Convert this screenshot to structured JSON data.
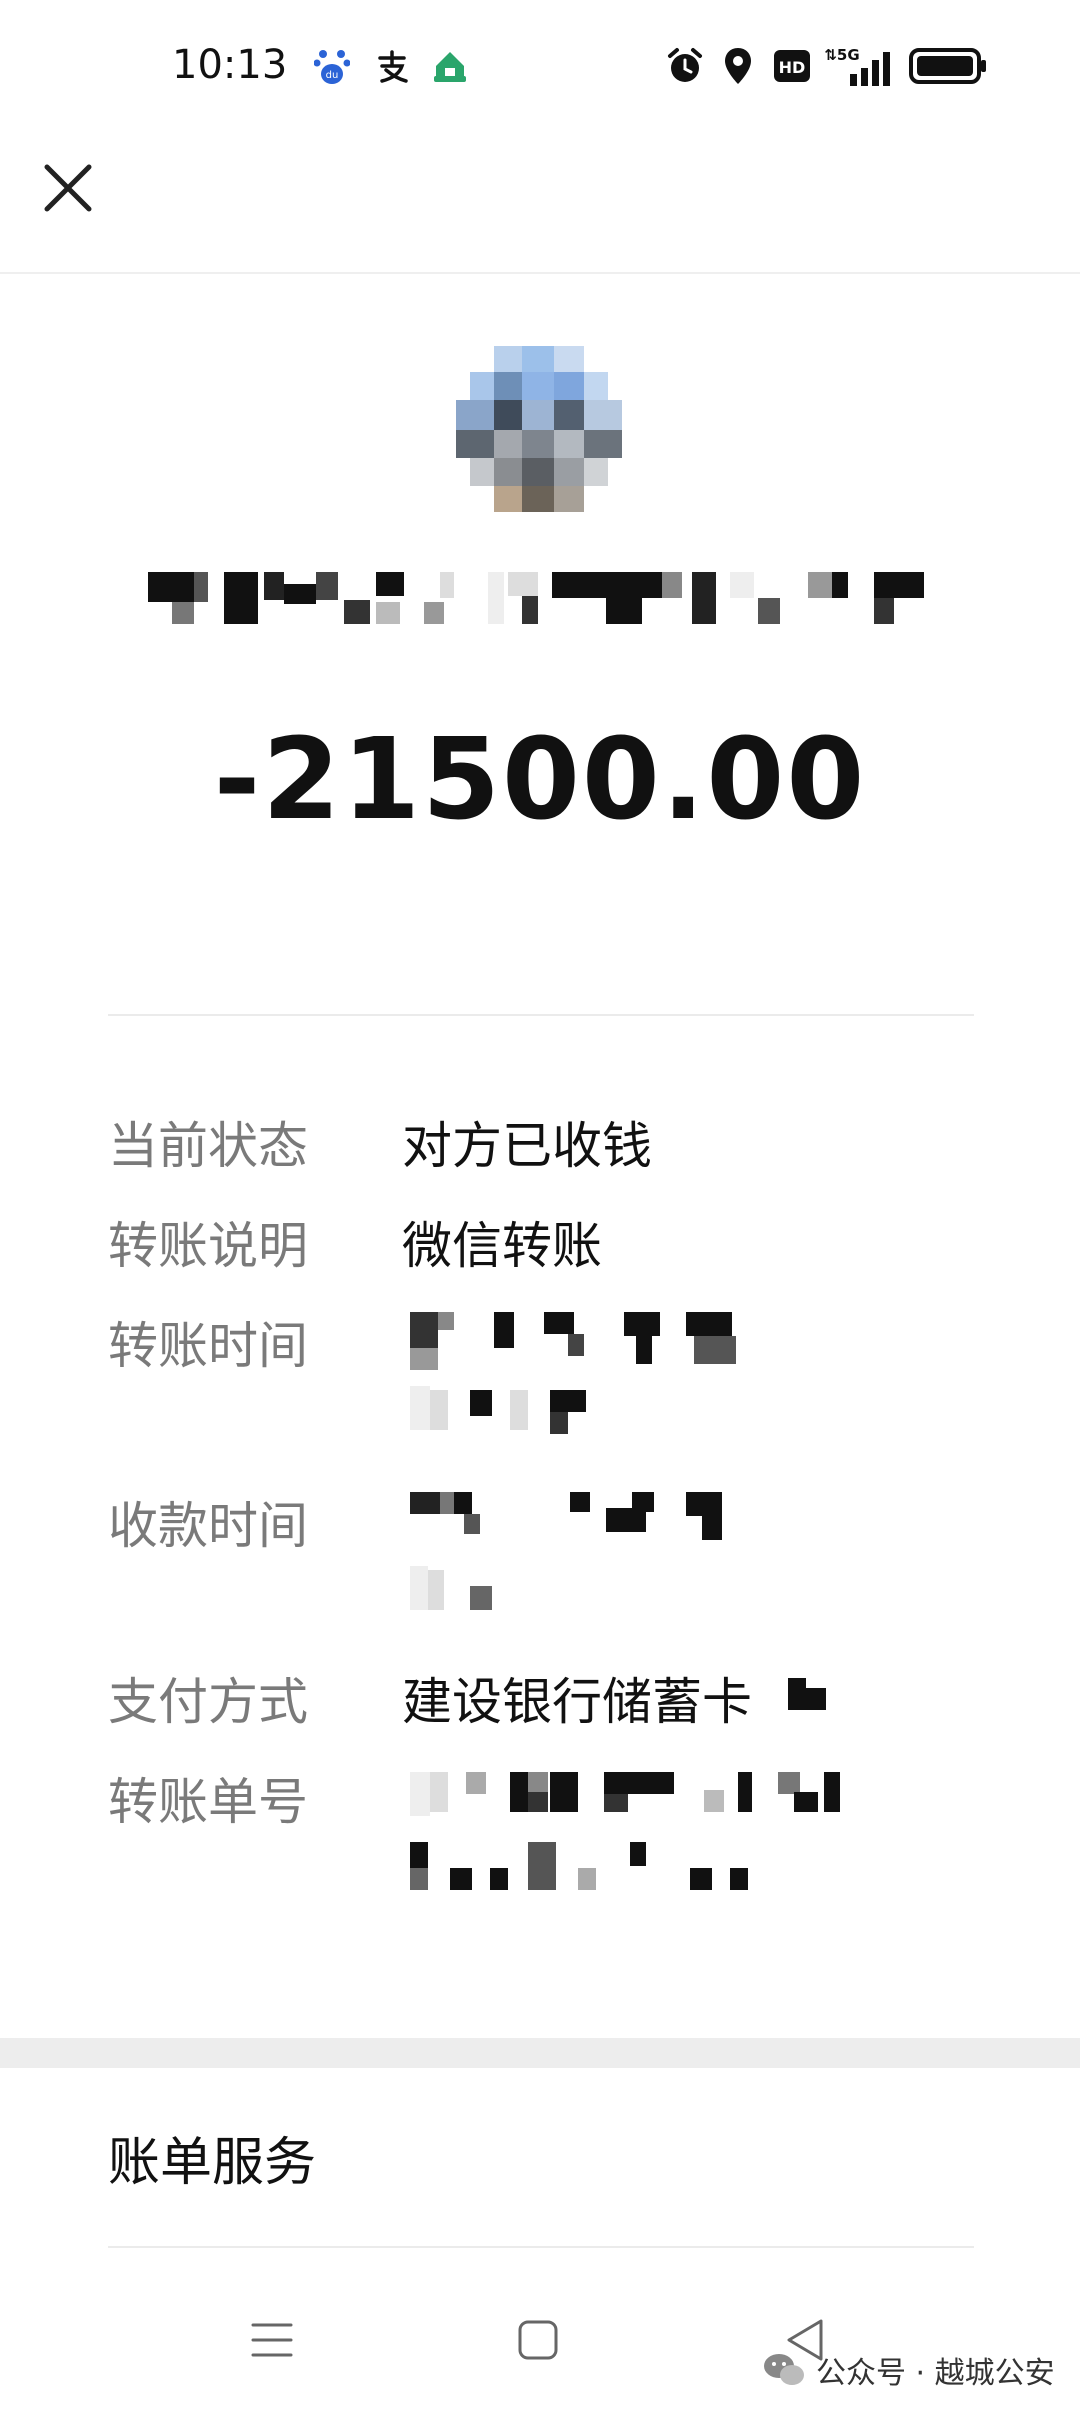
{
  "status_bar": {
    "time": "10:13"
  },
  "transaction": {
    "amount": "-21500.00",
    "details": [
      {
        "label": "当前状态",
        "value": "对方已收钱"
      },
      {
        "label": "转账说明",
        "value": "微信转账"
      },
      {
        "label": "转账时间",
        "value": ""
      },
      {
        "label": "收款时间",
        "value": ""
      },
      {
        "label": "支付方式",
        "value": "建设银行储蓄卡"
      },
      {
        "label": "转账单号",
        "value": ""
      }
    ]
  },
  "bill_service": {
    "label": "账单服务"
  },
  "watermark": {
    "text": "公众号 · 越城公安"
  },
  "colors": {
    "text": "#111111",
    "label_gray": "#7a7a7a",
    "divider": "#ebebeb",
    "gap_bg": "#ededed"
  }
}
